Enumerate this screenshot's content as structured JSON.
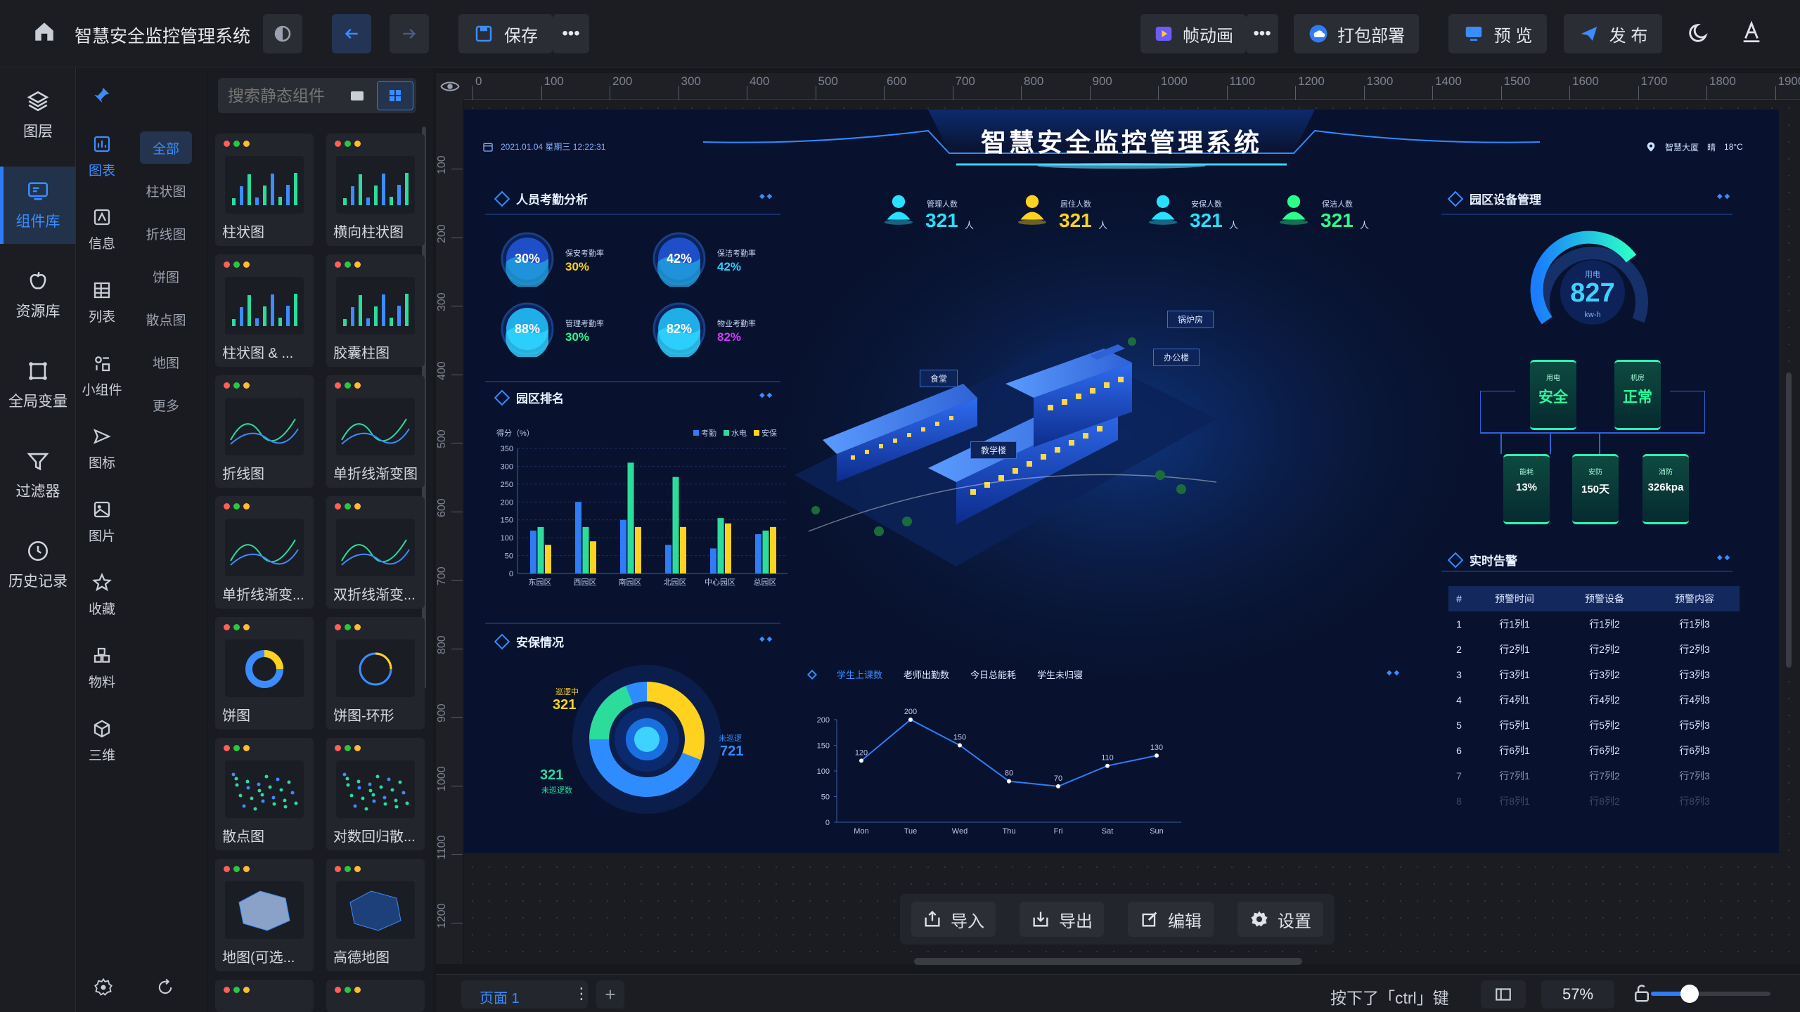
{
  "app": {
    "title": "智慧安全监控管理系统"
  },
  "toolbar": {
    "save_label": "保存",
    "frame_anim_label": "帧动画",
    "deploy_label": "打包部署",
    "preview_label": "预 览",
    "publish_label": "发 布"
  },
  "leftnav": {
    "items": [
      {
        "label": "图层"
      },
      {
        "label": "组件库"
      },
      {
        "label": "资源库"
      },
      {
        "label": "全局变量"
      },
      {
        "label": "过滤器"
      },
      {
        "label": "历史记录"
      }
    ]
  },
  "catnav": {
    "cats": [
      {
        "label": "图表"
      },
      {
        "label": "信息"
      },
      {
        "label": "列表"
      },
      {
        "label": "小组件"
      },
      {
        "label": "图标"
      },
      {
        "label": "图片"
      },
      {
        "label": "收藏"
      },
      {
        "label": "物料"
      },
      {
        "label": "三维"
      }
    ],
    "subs": [
      {
        "label": "全部"
      },
      {
        "label": "柱状图"
      },
      {
        "label": "折线图"
      },
      {
        "label": "饼图"
      },
      {
        "label": "散点图"
      },
      {
        "label": "地图"
      },
      {
        "label": "更多"
      }
    ]
  },
  "search": {
    "placeholder": "搜索静态组件"
  },
  "components": [
    {
      "label": "柱状图"
    },
    {
      "label": "横向柱状图"
    },
    {
      "label": "柱状图 & ..."
    },
    {
      "label": "胶囊柱图"
    },
    {
      "label": "折线图"
    },
    {
      "label": "单折线渐变图"
    },
    {
      "label": "单折线渐变..."
    },
    {
      "label": "双折线渐变..."
    },
    {
      "label": "饼图"
    },
    {
      "label": "饼图-环形"
    },
    {
      "label": "散点图"
    },
    {
      "label": "对数回归散..."
    },
    {
      "label": "地图(可选..."
    },
    {
      "label": "高德地图"
    }
  ],
  "ruler": {
    "ticks": [
      "0",
      "100",
      "200",
      "300",
      "400",
      "500",
      "600",
      "700",
      "800",
      "900",
      "1000",
      "1100",
      "1200",
      "1300",
      "1400",
      "1500",
      "1600",
      "1700",
      "1800",
      "1900"
    ],
    "vticks": [
      "100",
      "200",
      "300",
      "400",
      "500",
      "600",
      "700",
      "800",
      "900",
      "1000",
      "1100",
      "1200"
    ]
  },
  "screen": {
    "title": "智慧安全监控管理系统",
    "datetime": "2021.01.04  星期三 12:22:31",
    "location": "智慧大厦",
    "weather": "晴",
    "temp": "18°C",
    "attendance": {
      "title": "人员考勤分析",
      "items": [
        {
          "pct": "30%",
          "label": "保安考勤率",
          "value": "30%",
          "color": "#ffd21f"
        },
        {
          "pct": "42%",
          "label": "保洁考勤率",
          "value": "42%",
          "color": "#2ad2ff"
        },
        {
          "pct": "88%",
          "label": "管理考勤率",
          "value": "30%",
          "color": "#2bff8a"
        },
        {
          "pct": "82%",
          "label": "物业考勤率",
          "value": "82%",
          "color": "#d13bff"
        }
      ]
    },
    "stats": [
      {
        "label": "管理人数",
        "value": "321",
        "unit": "人",
        "color": "#28e0ff"
      },
      {
        "label": "居住人数",
        "value": "321",
        "unit": "人",
        "color": "#ffd21f"
      },
      {
        "label": "安保人数",
        "value": "321",
        "unit": "人",
        "color": "#28e0ff"
      },
      {
        "label": "保洁人数",
        "value": "321",
        "unit": "人",
        "color": "#2bff8a"
      }
    ],
    "ranking": {
      "title": "园区排名",
      "ylabel": "得分（%）",
      "legend": [
        "考勤",
        "水电",
        "安保"
      ]
    },
    "security": {
      "title": "安保情况",
      "a_label": "巡逻中",
      "a_value": "321",
      "b_label": "未巡逻",
      "b_value": "721",
      "c_label": "未巡逻数",
      "c_value": "321"
    },
    "building_labels": [
      {
        "label": "锅炉房"
      },
      {
        "label": "办公楼"
      },
      {
        "label": "食堂"
      },
      {
        "label": "教学楼"
      }
    ],
    "line_tabs": [
      {
        "label": "学生上课数"
      },
      {
        "label": "老师出勤数"
      },
      {
        "label": "今日总能耗"
      },
      {
        "label": "学生未归寝"
      }
    ],
    "equipment": {
      "title": "园区设备管理",
      "gauge_label": "用电",
      "gauge_value": "827",
      "gauge_unit": "kw-h",
      "status": [
        {
          "label": "用电",
          "value": "安全"
        },
        {
          "label": "机房",
          "value": "正常"
        }
      ],
      "meters": [
        {
          "label": "能耗",
          "value": "13%"
        },
        {
          "label": "安防",
          "value": "150天"
        },
        {
          "label": "消防",
          "value": "326kpa"
        }
      ]
    },
    "alarm": {
      "title": "实时告警",
      "headers": [
        "#",
        "预警时间",
        "预警设备",
        "预警内容"
      ],
      "rows": [
        [
          "1",
          "行1列1",
          "行1列2",
          "行1列3"
        ],
        [
          "2",
          "行2列1",
          "行2列2",
          "行2列3"
        ],
        [
          "3",
          "行3列1",
          "行3列2",
          "行3列3"
        ],
        [
          "4",
          "行4列1",
          "行4列2",
          "行4列3"
        ],
        [
          "5",
          "行5列1",
          "行5列2",
          "行5列3"
        ],
        [
          "6",
          "行6列1",
          "行6列2",
          "行6列3"
        ],
        [
          "7",
          "行7列1",
          "行7列2",
          "行7列3"
        ],
        [
          "8",
          "行8列1",
          "行8列2",
          "行8列3"
        ]
      ]
    }
  },
  "bottom_tools": {
    "import": "导入",
    "export": "导出",
    "edit": "编辑",
    "settings": "设置"
  },
  "status": {
    "page": "页面 1",
    "hint": "按下了「ctrl」键",
    "zoom": "57%"
  },
  "chart_data": [
    {
      "type": "bar",
      "categories": [
        "东园区",
        "西园区",
        "南园区",
        "北园区",
        "中心园区",
        "总园区"
      ],
      "series": [
        {
          "name": "考勤",
          "values": [
            120,
            200,
            150,
            80,
            70,
            110
          ]
        },
        {
          "name": "水电",
          "values": [
            130,
            130,
            310,
            270,
            155,
            120
          ]
        },
        {
          "name": "安保",
          "values": [
            80,
            90,
            130,
            130,
            140,
            130
          ]
        }
      ],
      "ylabel": "得分（%）",
      "ylim": [
        0,
        350
      ],
      "yticks": [
        0,
        50,
        100,
        150,
        200,
        250,
        300,
        350
      ],
      "legend": "top-right",
      "colors": [
        "#2f7cf6",
        "#2bdc9b",
        "#ffd21f"
      ]
    },
    {
      "type": "line",
      "categories": [
        "Mon",
        "Tue",
        "Wed",
        "Thu",
        "Fri",
        "Sat",
        "Sun"
      ],
      "series": [
        {
          "values": [
            120,
            200,
            150,
            80,
            70,
            110,
            130
          ]
        }
      ],
      "ylim": [
        0,
        200
      ],
      "yticks": [
        0,
        50,
        100,
        150,
        200
      ],
      "color": "#2f7cf6"
    },
    {
      "type": "pie",
      "slices": [
        {
          "label": "巡逻中",
          "value": 321
        },
        {
          "label": "未巡逻",
          "value": 721
        }
      ],
      "colors": [
        "#ffd21f",
        "#2f8cff",
        "#2bdc9b"
      ]
    }
  ]
}
